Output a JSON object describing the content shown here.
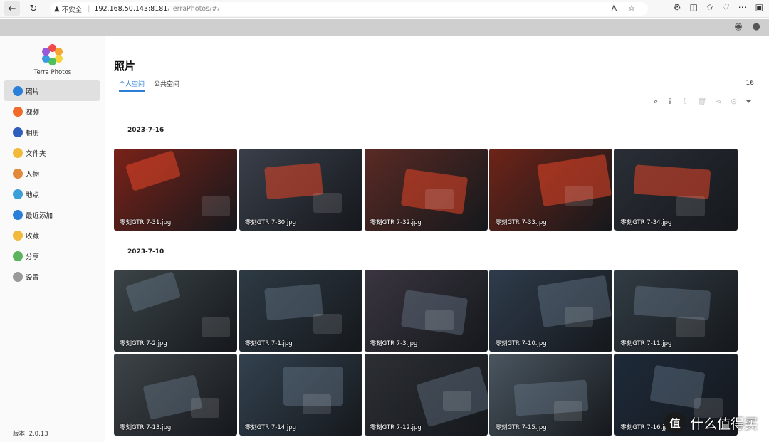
{
  "browser": {
    "warning_label": "不安全",
    "url_host": "192.168.50.143:8181",
    "url_path": "/TerraPhotos/#/"
  },
  "app": {
    "brand": "Terra Photos",
    "version": "版本: 2.0.13"
  },
  "sidebar": {
    "items": [
      {
        "label": "照片",
        "icon": "photo-icon",
        "color": "#2b7fd8"
      },
      {
        "label": "视频",
        "icon": "video-icon",
        "color": "#f06a2a"
      },
      {
        "label": "相册",
        "icon": "album-icon",
        "color": "#2f5fbd"
      },
      {
        "label": "文件夹",
        "icon": "folder-icon",
        "color": "#f2b93b"
      },
      {
        "label": "人物",
        "icon": "person-icon",
        "color": "#e08a3a"
      },
      {
        "label": "地点",
        "icon": "location-icon",
        "color": "#3aa0d8"
      },
      {
        "label": "最近添加",
        "icon": "recent-icon",
        "color": "#2b7fd8"
      },
      {
        "label": "收藏",
        "icon": "star-icon",
        "color": "#f2b93b"
      },
      {
        "label": "分享",
        "icon": "share-icon",
        "color": "#5bb35b"
      },
      {
        "label": "设置",
        "icon": "gear-icon",
        "color": "#9a9a9a"
      }
    ]
  },
  "main": {
    "title": "照片",
    "tabs": [
      {
        "label": "个人空间"
      },
      {
        "label": "公共空间"
      }
    ],
    "count": "16",
    "groups": [
      {
        "date": "2023-7-16",
        "photos": [
          {
            "name": "零刻GTR 7-31.jpg",
            "tone": "#7a2218"
          },
          {
            "name": "零刻GTR 7-30.jpg",
            "tone": "#3a3f4a"
          },
          {
            "name": "零刻GTR 7-32.jpg",
            "tone": "#5a2a24"
          },
          {
            "name": "零刻GTR 7-33.jpg",
            "tone": "#6e2418"
          },
          {
            "name": "零刻GTR 7-34.jpg",
            "tone": "#2a2e36"
          }
        ]
      },
      {
        "date": "2023-7-10",
        "photos": [
          {
            "name": "零刻GTR 7-2.jpg",
            "tone": "#3b4448"
          },
          {
            "name": "零刻GTR 7-1.jpg",
            "tone": "#2e3a44"
          },
          {
            "name": "零刻GTR 7-3.jpg",
            "tone": "#3a3540"
          },
          {
            "name": "零刻GTR 7-10.jpg",
            "tone": "#2f3c4c"
          },
          {
            "name": "零刻GTR 7-11.jpg",
            "tone": "#323c44"
          },
          {
            "name": "零刻GTR 7-13.jpg",
            "tone": "#3e4448"
          },
          {
            "name": "零刻GTR 7-14.jpg",
            "tone": "#334250"
          },
          {
            "name": "零刻GTR 7-12.jpg",
            "tone": "#2c2f34"
          },
          {
            "name": "零刻GTR 7-15.jpg",
            "tone": "#4a5660"
          },
          {
            "name": "零刻GTR 7-16.jpg",
            "tone": "#1e2a3a"
          }
        ]
      }
    ]
  },
  "watermark": {
    "badge": "值",
    "text": "什么值得买"
  }
}
